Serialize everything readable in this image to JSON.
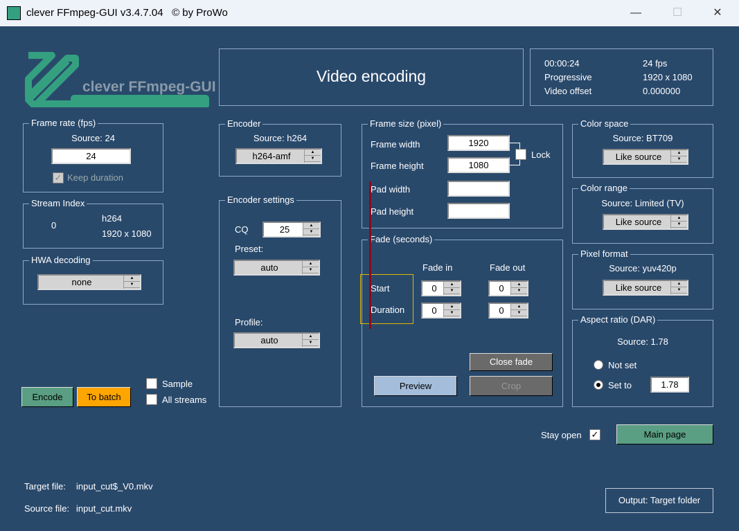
{
  "window": {
    "title": "clever FFmpeg-GUI v3.4.7.04   © by ProWo",
    "minimize": "—",
    "maximize": "☐",
    "close": "✕"
  },
  "logo": {
    "text": "clever FFmpeg-GUI"
  },
  "header": {
    "title": "Video encoding"
  },
  "info": {
    "duration": "00:00:24",
    "fps": "24 fps",
    "scan": "Progressive",
    "resolution": "1920 x 1080",
    "offset_label": "Video offset",
    "offset_value": "0.000000"
  },
  "frame_rate": {
    "legend": "Frame rate (fps)",
    "source": "Source: 24",
    "value": "24",
    "keep_duration": "Keep duration"
  },
  "stream_index": {
    "legend": "Stream Index",
    "index": "0",
    "codec": "h264",
    "resolution": "1920 x 1080"
  },
  "hwa": {
    "legend": "HWA decoding",
    "value": "none"
  },
  "encoder": {
    "legend": "Encoder",
    "source": "Source: h264",
    "value": "h264-amf"
  },
  "encoder_settings": {
    "legend": "Encoder settings",
    "cq_label": "CQ",
    "cq_value": "25",
    "preset_label": "Preset:",
    "preset_value": "auto",
    "profile_label": "Profile:",
    "profile_value": "auto"
  },
  "frame_size": {
    "legend": "Frame size (pixel)",
    "width_label": "Frame width",
    "width_value": "1920",
    "height_label": "Frame height",
    "height_value": "1080",
    "lock": "Lock",
    "pad_width_label": "Pad width",
    "pad_height_label": "Pad height"
  },
  "fade": {
    "legend": "Fade (seconds)",
    "fade_in": "Fade in",
    "fade_out": "Fade out",
    "start": "Start",
    "duration": "Duration",
    "start_in": "0",
    "start_out": "0",
    "dur_in": "0",
    "dur_out": "0",
    "close_fade": "Close fade",
    "preview": "Preview",
    "crop": "Crop"
  },
  "color_space": {
    "legend": "Color space",
    "source": "Source: BT709",
    "value": "Like source"
  },
  "color_range": {
    "legend": "Color range",
    "source": "Source: Limited (TV)",
    "value": "Like source"
  },
  "pixel_format": {
    "legend": "Pixel format",
    "source": "Source: yuv420p",
    "value": "Like source"
  },
  "aspect": {
    "legend": "Aspect ratio (DAR)",
    "source": "Source: 1.78",
    "not_set": "Not set",
    "set_to": "Set to",
    "value": "1.78"
  },
  "actions": {
    "encode": "Encode",
    "to_batch": "To batch",
    "sample": "Sample",
    "all_streams": "All streams",
    "stay_open": "Stay open",
    "main_page": "Main page",
    "output": "Output: Target folder"
  },
  "files": {
    "target_label": "Target file:",
    "target_value": "input_cut$_V0.mkv",
    "source_label": "Source file:",
    "source_value": "input_cut.mkv"
  },
  "colors": {
    "bg": "#29496b",
    "encode": "#5a9e84",
    "batch": "#ffa500",
    "logo": "#34a080"
  }
}
